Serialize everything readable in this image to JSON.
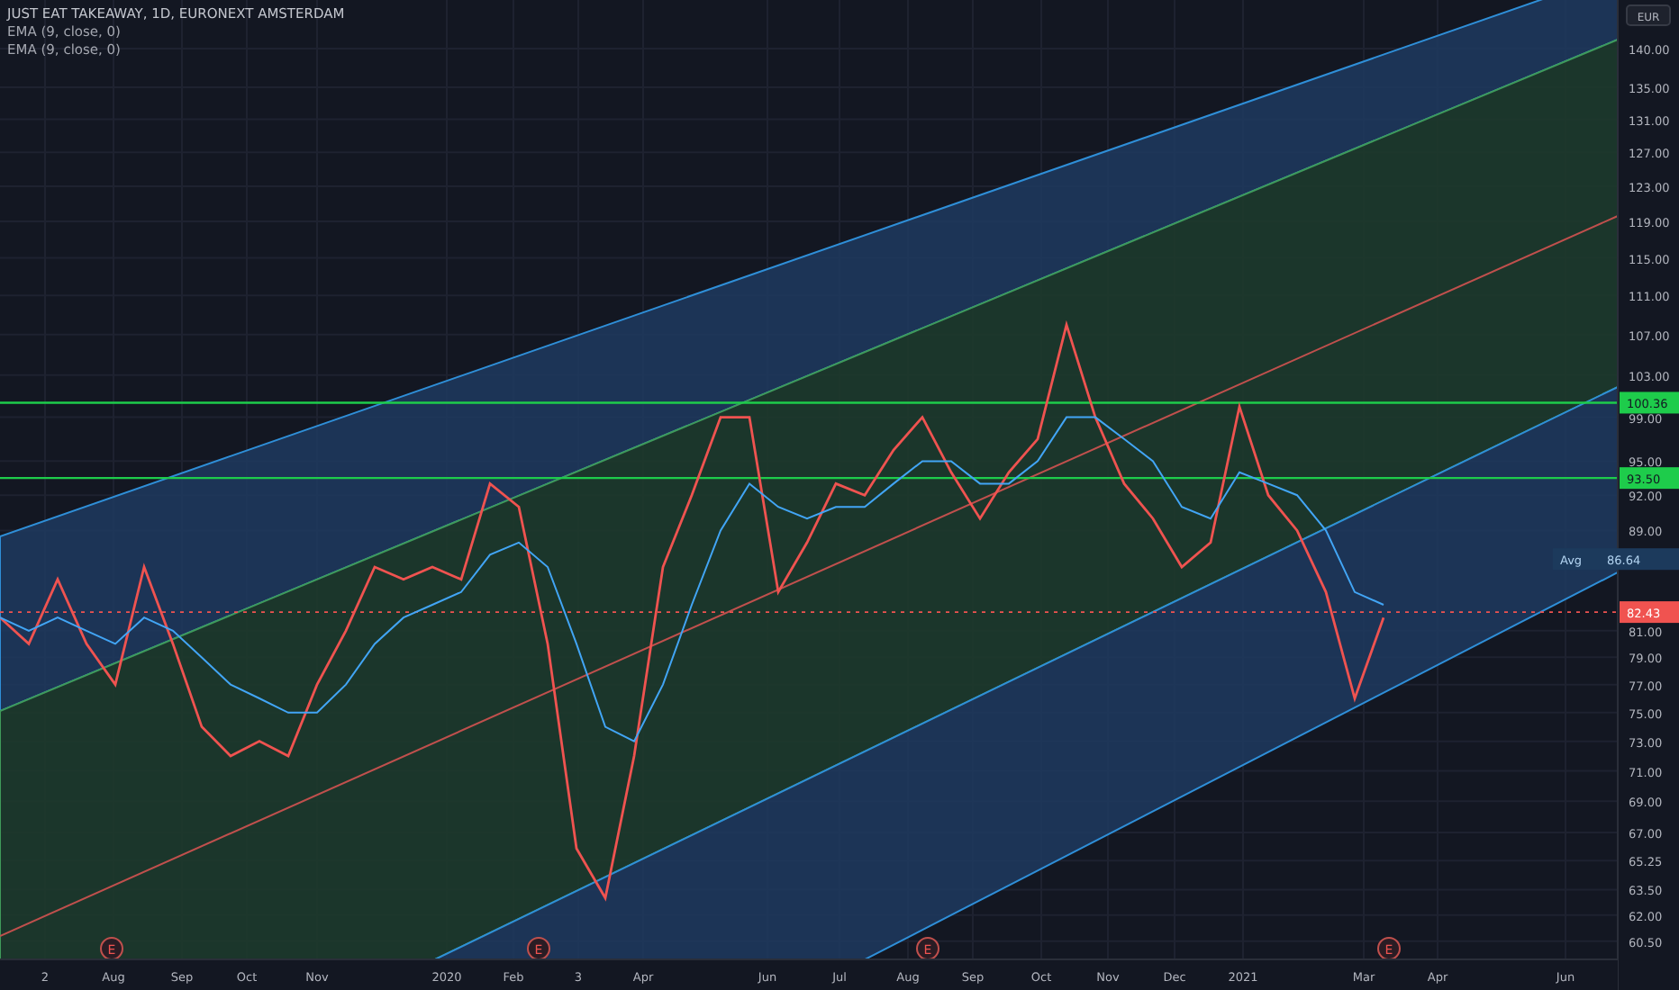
{
  "legend": {
    "title": "JUST EAT TAKEAWAY, 1D, EURONEXT AMSTERDAM",
    "indicators": [
      "EMA (9, close, 0)",
      "EMA (9, close, 0)"
    ]
  },
  "currency": "EUR",
  "price_axis": {
    "labels": [
      "140.00",
      "135.00",
      "131.00",
      "127.00",
      "123.00",
      "119.00",
      "115.00",
      "111.00",
      "107.00",
      "103.00",
      "99.00",
      "95.00",
      "92.00",
      "89.00",
      "81.00",
      "79.00",
      "77.00",
      "75.00",
      "73.00",
      "71.00",
      "69.00",
      "67.00",
      "65.25",
      "63.50",
      "62.00",
      "60.50"
    ]
  },
  "time_axis": {
    "labels": [
      "2",
      "Aug",
      "Sep",
      "Oct",
      "Nov",
      "2020",
      "Feb",
      "3",
      "Apr",
      "Jun",
      "Jul",
      "Aug",
      "Sep",
      "Oct",
      "Nov",
      "Dec",
      "2021",
      "Mar",
      "Apr",
      "Jun"
    ]
  },
  "price_levels": [
    {
      "label": "100.36",
      "color": "#1ecc4b"
    },
    {
      "label": "93.50",
      "color": "#1ecc4b"
    }
  ],
  "average": {
    "label": "Avg",
    "value": "86.64"
  },
  "last_price": {
    "label": "82.43",
    "color": "#f05350"
  },
  "earnings_markers": [
    {
      "label": "E"
    },
    {
      "label": "E"
    },
    {
      "label": "E"
    },
    {
      "label": "E"
    }
  ]
}
